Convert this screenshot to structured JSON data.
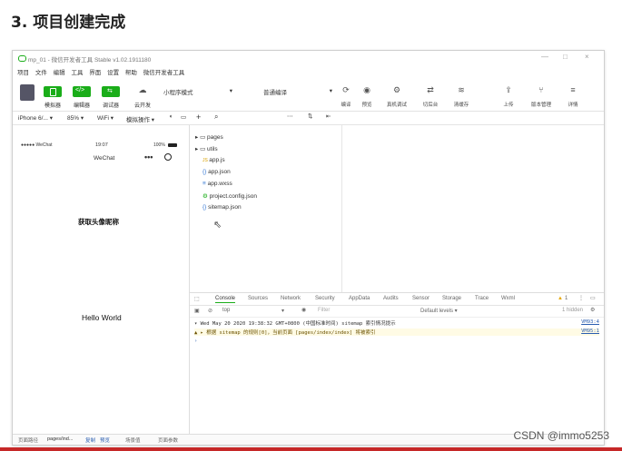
{
  "heading": "3. 项目创建完成",
  "window": {
    "title": "mp_01 - 微信开发者工具 Stable v1.02.1911180",
    "controls": [
      "—",
      "□",
      "×"
    ]
  },
  "menu": [
    "项目",
    "文件",
    "编辑",
    "工具",
    "界面",
    "设置",
    "帮助",
    "微信开发者工具"
  ],
  "toolbar": {
    "left": [
      {
        "label": "模拟器",
        "icon": "phone-icon"
      },
      {
        "label": "编辑器",
        "icon": "code-icon"
      },
      {
        "label": "调试器",
        "icon": "debug-icon"
      },
      {
        "label": "云开发",
        "icon": "cloud-icon"
      }
    ],
    "mode_select": "小程序模式",
    "compile_select": "普通编译",
    "right": [
      {
        "label": "编译",
        "icon": "refresh-icon"
      },
      {
        "label": "预览",
        "icon": "eye-icon"
      },
      {
        "label": "真机调试",
        "icon": "gear-icon"
      },
      {
        "label": "切后台",
        "icon": "switch-icon"
      },
      {
        "label": "清缓存",
        "icon": "layers-icon"
      },
      {
        "label": "上传",
        "icon": "upload-icon"
      },
      {
        "label": "版本管理",
        "icon": "branch-icon"
      },
      {
        "label": "详情",
        "icon": "menu-icon"
      }
    ]
  },
  "subbar": {
    "device": "iPhone 6/...",
    "zoom": "85%",
    "network": "WiFi",
    "operate": "模拟操作"
  },
  "simulator": {
    "carrier": "●●●●● WeChat",
    "time": "19:07",
    "battery": "100%",
    "nav_title": "WeChat",
    "avatar_button": "获取头像昵称",
    "hello": "Hello World"
  },
  "tree": [
    {
      "type": "folder",
      "name": "pages"
    },
    {
      "type": "folder",
      "name": "utils"
    },
    {
      "type": "js",
      "name": "app.js"
    },
    {
      "type": "json",
      "name": "app.json"
    },
    {
      "type": "wxss",
      "name": "app.wxss"
    },
    {
      "type": "config",
      "name": "project.config.json"
    },
    {
      "type": "json",
      "name": "sitemap.json"
    }
  ],
  "devtools": {
    "tabs": [
      "Console",
      "Sources",
      "Network",
      "Security",
      "AppData",
      "Audits",
      "Sensor",
      "Storage",
      "Trace",
      "Wxml"
    ],
    "warn_count": "1",
    "context": "top",
    "filter_placeholder": "Filter",
    "levels": "Default levels ▾",
    "hidden": "1 hidden",
    "logs": [
      {
        "text": "▾ Wed May 20 2020 19:38:32 GMT+0800 (中国标准时间) sitemap 索引情况提示",
        "src": "VM93:4"
      },
      {
        "text": "▲ ▸ 根据 sitemap 的规则[0]，当前页面 [pages/index/index] 将被索引",
        "src": "VM95:1"
      }
    ]
  },
  "status": {
    "path_label": "页面路径",
    "path": "pages/ind...",
    "copy": "复制",
    "preview": "预览",
    "scene": "场景值",
    "params": "页面参数"
  },
  "watermark": "CSDN @immo5253"
}
